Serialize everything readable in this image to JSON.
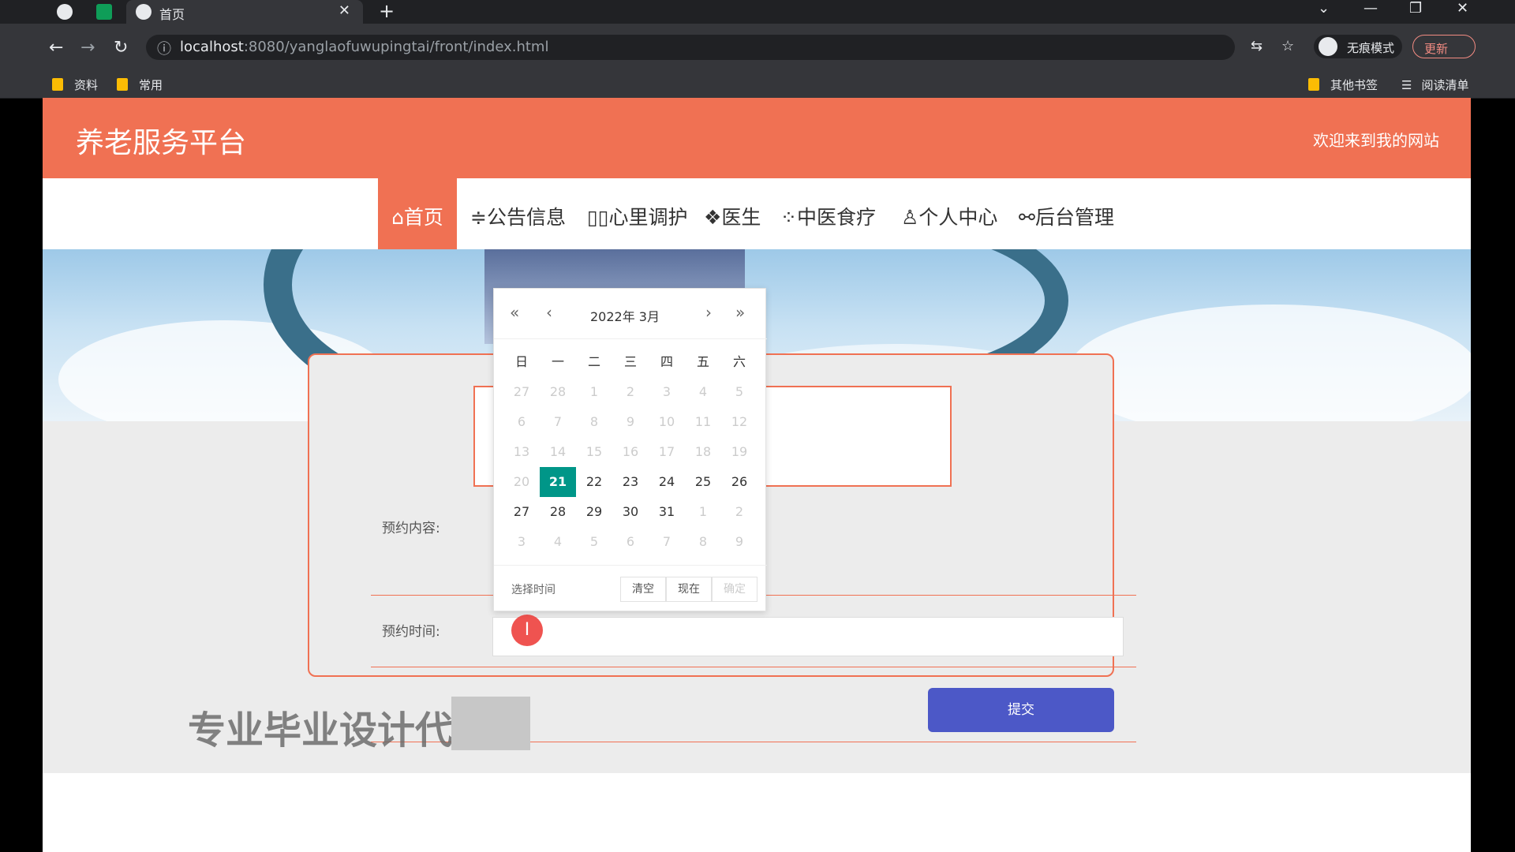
{
  "browser": {
    "tab_title": "首页",
    "url_host": "localhost",
    "url_rest": ":8080/yanglaofuwupingtai/front/index.html",
    "incognito_label": "无痕模式",
    "update_label": "更新",
    "bookmarks": [
      "资料",
      "常用"
    ],
    "bookmarks_right": [
      "其他书签",
      "阅读清单"
    ]
  },
  "site": {
    "brand": "养老服务平台",
    "welcome": "欢迎来到我的网站",
    "nav": [
      {
        "label": "⌂首页",
        "active": true
      },
      {
        "label": "≑公告信息",
        "active": false
      },
      {
        "label": "▯▯心里调护",
        "active": false
      },
      {
        "label": "❖医生",
        "active": false
      },
      {
        "label": "⁘中医食疗",
        "active": false
      },
      {
        "label": "♙个人中心",
        "active": false
      },
      {
        "label": "⚯后台管理",
        "active": false
      }
    ]
  },
  "form": {
    "content_label": "预约内容:",
    "time_label": "预约时间:",
    "submit_label": "提交"
  },
  "calendar": {
    "header": "2022年  3月",
    "weekdays": [
      "日",
      "一",
      "二",
      "三",
      "四",
      "五",
      "六"
    ],
    "days": [
      [
        "27",
        "28",
        "1",
        "2",
        "3",
        "4",
        "5"
      ],
      [
        "6",
        "7",
        "8",
        "9",
        "10",
        "11",
        "12"
      ],
      [
        "13",
        "14",
        "15",
        "16",
        "17",
        "18",
        "19"
      ],
      [
        "20",
        "21",
        "22",
        "23",
        "24",
        "25",
        "26"
      ],
      [
        "27",
        "28",
        "29",
        "30",
        "31",
        "1",
        "2"
      ],
      [
        "3",
        "4",
        "5",
        "6",
        "7",
        "8",
        "9"
      ]
    ],
    "selected_day": "21",
    "select_time_label": "选择时间",
    "clear_label": "清空",
    "now_label": "现在",
    "confirm_label": "确定"
  },
  "watermark": "专业毕业设计代"
}
